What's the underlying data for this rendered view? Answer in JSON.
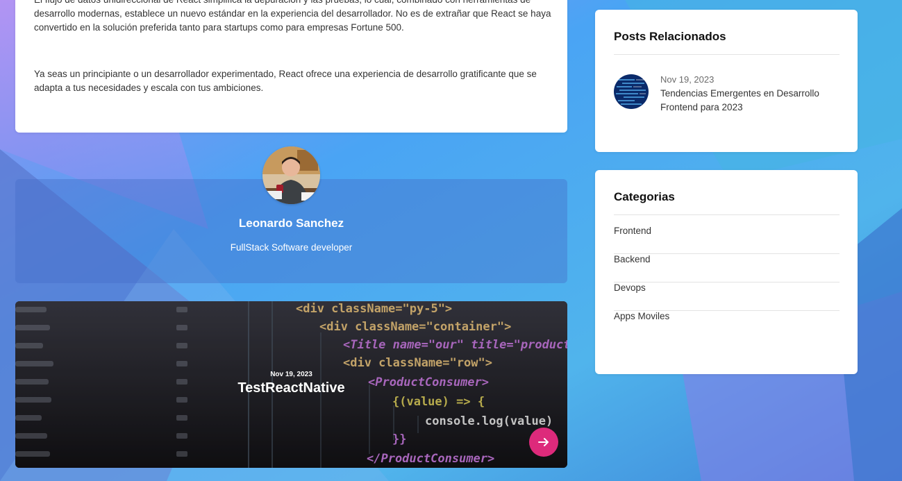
{
  "article": {
    "paragraph1": "El flujo de datos unidireccional de React simplifica la depuración y las pruebas, lo cual, combinado con herramientas de desarrollo modernas, establece un nuevo estándar en la experiencia del desarrollador. No es de extrañar que React se haya convertido en la solución preferida tanto para startups como para empresas Fortune 500.",
    "paragraph2": "Ya seas un principiante o un desarrollador experimentado, React ofrece una experiencia de desarrollo gratificante que se adapta a tus necesidades y escala con tus ambiciones."
  },
  "author": {
    "name": "Leonardo Sanchez",
    "role": "FullStack Software developer"
  },
  "post": {
    "date": "Nov 19, 2023",
    "title": "TestReactNative",
    "icon": "arrow-right-icon",
    "accent": "#dd2a7b",
    "code_lines": [
      "<div className=\"py-5\">",
      "<div className=\"container\">",
      "<Title name=\"our\" title=\"product",
      "<div className=\"row\">",
      "<ProductConsumer>",
      "{(value) => {",
      "console.log(value)",
      "}}",
      "</ProductConsumer>"
    ]
  },
  "related": {
    "heading": "Posts Relacionados",
    "items": [
      {
        "date": "Nov 19, 2023",
        "title": "Tendencias Emergentes en Desarrollo Frontend para 2023"
      }
    ]
  },
  "categories": {
    "heading": "Categorias",
    "items": [
      "Frontend",
      "Backend",
      "Devops",
      "Apps Moviles"
    ]
  }
}
